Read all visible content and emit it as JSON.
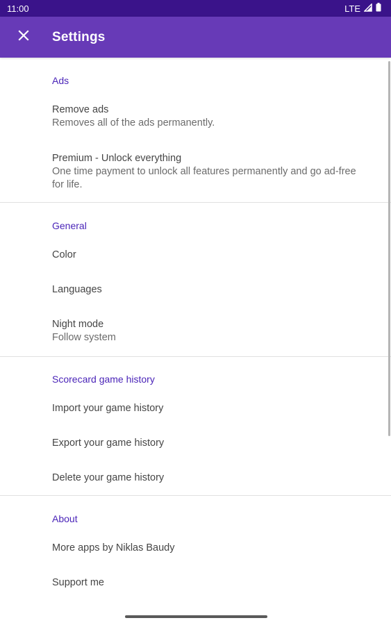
{
  "status_bar": {
    "time": "11:00",
    "network": "LTE"
  },
  "app_bar": {
    "title": "Settings",
    "close_icon": "close-icon",
    "background_color": "#673ab7",
    "status_color": "#3a138a"
  },
  "accent_color": "#4a24b8",
  "sections": {
    "ads": {
      "header": "Ads",
      "remove_ads": {
        "title": "Remove ads",
        "summary": "Removes all of the ads permanently."
      },
      "premium": {
        "title": "Premium - Unlock everything",
        "summary_line1": "One time payment to unlock all features permanently and go ad-free",
        "summary_line2": "for life."
      }
    },
    "general": {
      "header": "General",
      "color": {
        "title": "Color"
      },
      "languages": {
        "title": "Languages"
      },
      "night_mode": {
        "title": "Night mode",
        "summary": "Follow system"
      }
    },
    "history": {
      "header": "Scorecard game history",
      "import": {
        "title": "Import your game history"
      },
      "export": {
        "title": "Export your game history"
      },
      "delete": {
        "title": "Delete your game history"
      }
    },
    "about": {
      "header": "About",
      "more_apps": {
        "title": "More apps by Niklas Baudy"
      },
      "support": {
        "title": "Support me"
      }
    }
  }
}
